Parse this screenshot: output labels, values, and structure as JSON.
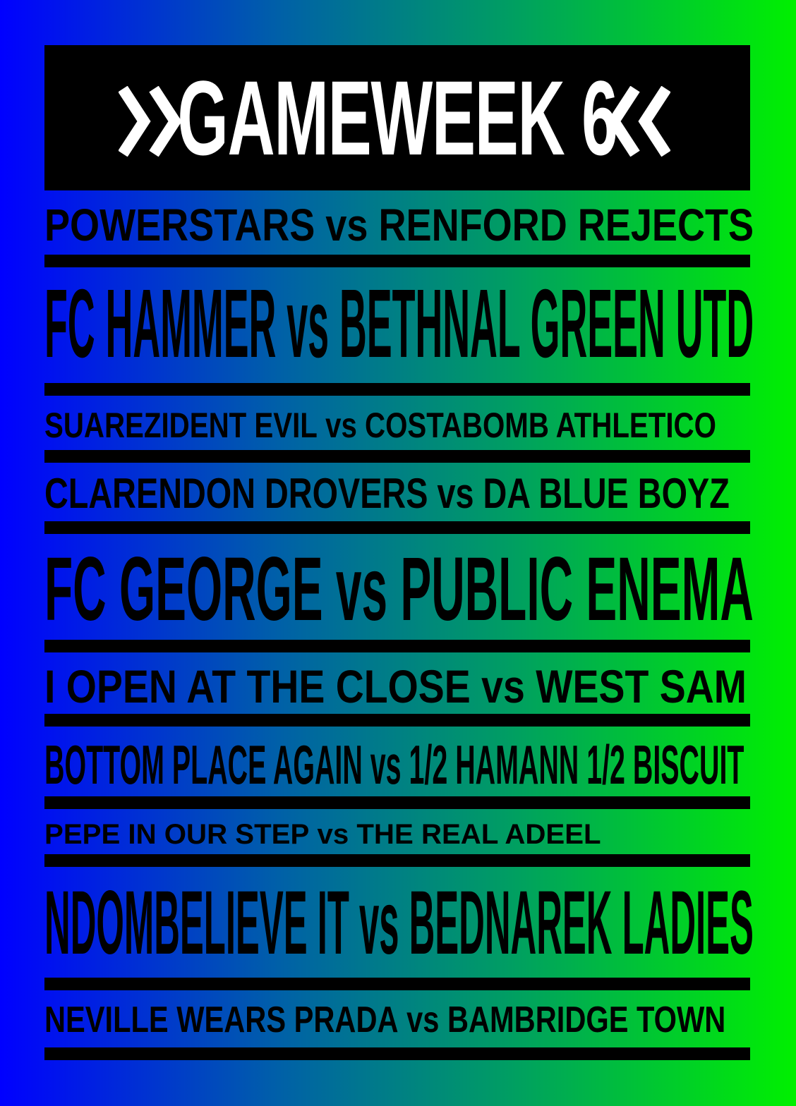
{
  "header": {
    "title": "GAMEWEEK 6",
    "left_icon": "double-chevron-right-icon",
    "right_icon": "double-chevron-left-icon"
  },
  "colors": {
    "gradient_left": "#0000ff",
    "gradient_right": "#00f000",
    "ink": "#000000",
    "header_text": "#ffffff"
  },
  "fixtures": [
    {
      "home": "POWERSTARS",
      "vs": "vs",
      "away": "RENFORD REJECTS"
    },
    {
      "home": "FC HAMMER",
      "vs": "vs",
      "away": "BETHNAL GREEN UTD"
    },
    {
      "home": "SUAREZIDENT EVIL",
      "vs": "vs",
      "away": "COSTABOMB ATHLETICO"
    },
    {
      "home": "CLARENDON DROVERS",
      "vs": "vs",
      "away": "DA BLUE BOYZ"
    },
    {
      "home": "FC GEORGE",
      "vs": "vs",
      "away": "PUBLIC ENEMA"
    },
    {
      "home": "I OPEN AT THE CLOSE",
      "vs": "vs",
      "away": "WEST SAM"
    },
    {
      "home": "BOTTOM PLACE AGAIN",
      "vs": "vs",
      "away": "1/2 HAMANN 1/2 BISCUIT"
    },
    {
      "home": "PEPE IN OUR STEP",
      "vs": "vs",
      "away": "THE REAL ADEEL"
    },
    {
      "home": "NDOMBELIEVE IT",
      "vs": "vs",
      "away": "BEDNAREK LADIES"
    },
    {
      "home": "NEVILLE WEARS PRADA",
      "vs": "vs",
      "away": "BAMBRIDGE TOWN"
    }
  ]
}
